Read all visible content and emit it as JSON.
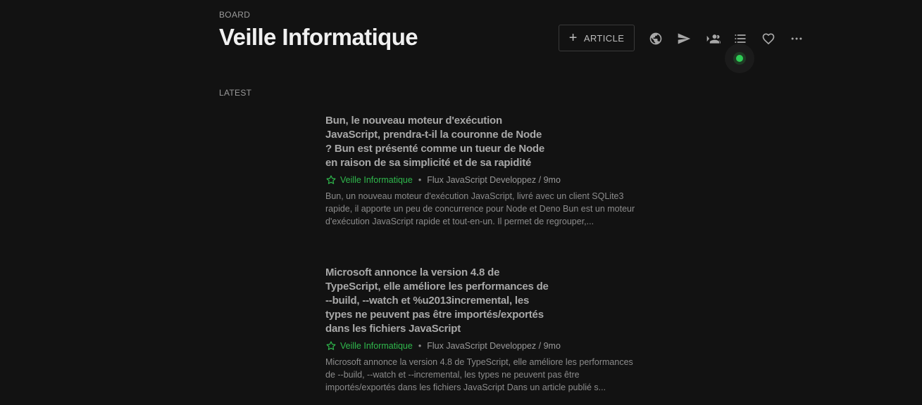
{
  "header": {
    "overline": "BOARD",
    "title": "Veille Informatique"
  },
  "toolbar": {
    "article_button_label": "ARTICLE",
    "icons": [
      "public-icon",
      "send-icon",
      "people-icon",
      "list-icon",
      "heart-icon",
      "more-icon"
    ]
  },
  "section": {
    "label": "LATEST"
  },
  "entries": [
    {
      "title": "Bun, le nouveau moteur d'exécution JavaScript, prendra-t-il la couronne de Node ? Bun est présenté comme un tueur de Node en raison de sa simplicité et de sa rapidité",
      "feed": "Veille Informatique",
      "source": "Flux JavaScript Developpez / 9mo",
      "summary": "Bun, un nouveau moteur d'exécution JavaScript, livré avec un client SQLite3 rapide, il apporte un peu de concurrence pour Node et Deno Bun est un moteur d'exécution JavaScript rapide et tout-en-un. Il permet de regrouper,..."
    },
    {
      "title": "Microsoft annonce la version 4.8 de TypeScript, elle améliore les performances de --build, --watch et %u2013incremental, les types ne peuvent pas être importés/exportés dans les fichiers JavaScript",
      "feed": "Veille Informatique",
      "source": "Flux JavaScript Developpez / 9mo",
      "summary": "Microsoft annonce la version 4.8 de TypeScript, elle améliore les performances de --build, --watch et --incremental, les types ne peuvent pas être importés/exportés dans les fichiers JavaScript Dans un article publié s..."
    }
  ],
  "colors": {
    "background": "#121212",
    "accent_green": "#2fb84c",
    "status_green": "#2ecc55"
  }
}
